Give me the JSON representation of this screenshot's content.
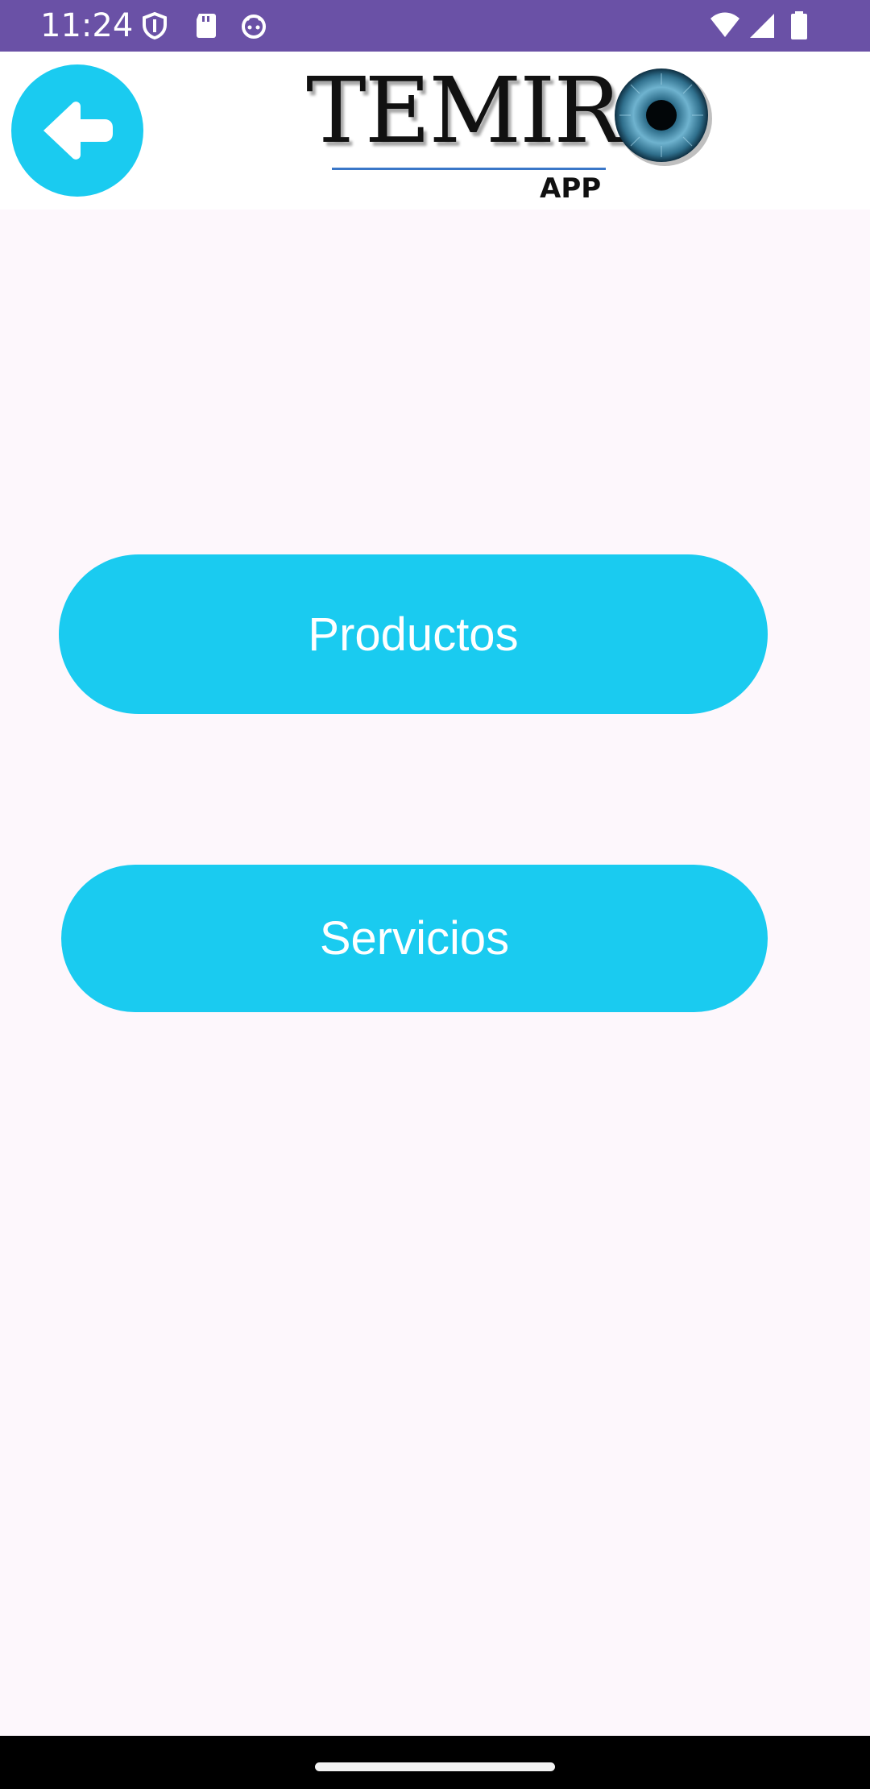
{
  "status_bar": {
    "time": "11:24",
    "background": "#6a51a6",
    "icons_left": [
      "shield-icon",
      "sd-card-icon",
      "android-face-icon"
    ],
    "icons_right": [
      "wifi-icon",
      "cell-signal-icon",
      "battery-icon"
    ]
  },
  "header": {
    "back_icon": "arrow-left-icon",
    "logo_text": "TEMIR",
    "logo_subtext": "APP",
    "accent": "#1acbf0"
  },
  "main": {
    "buttons": [
      {
        "label": "Productos"
      },
      {
        "label": "Servicios"
      }
    ]
  },
  "nav_bar": {
    "home_indicator": "home-pill"
  }
}
